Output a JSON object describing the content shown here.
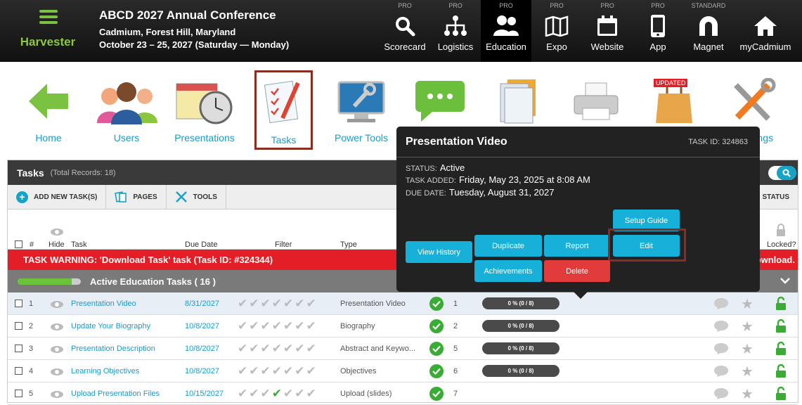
{
  "app": {
    "name": "Harvester"
  },
  "conference": {
    "title": "ABCD 2027 Annual Conference",
    "location": "Cadmium, Forest Hill, Maryland",
    "dates": "October 23 – 25, 2027 (Saturday — Monday)"
  },
  "modules": [
    {
      "tier": "PRO",
      "label": "Scorecard",
      "icon": "search-icon"
    },
    {
      "tier": "PRO",
      "label": "Logistics",
      "icon": "hierarchy-icon"
    },
    {
      "tier": "PRO",
      "label": "Education",
      "icon": "users-icon"
    },
    {
      "tier": "PRO",
      "label": "Expo",
      "icon": "map-icon"
    },
    {
      "tier": "PRO",
      "label": "Website",
      "icon": "calendar-icon"
    },
    {
      "tier": "PRO",
      "label": "App",
      "icon": "phone-icon"
    },
    {
      "tier": "STANDARD",
      "label": "Magnet",
      "icon": "magnet-icon"
    },
    {
      "tier": "",
      "label": "myCadmium",
      "icon": "home-icon"
    }
  ],
  "launcher": [
    {
      "label": "Home",
      "icon": "green-arrow-icon"
    },
    {
      "label": "Users",
      "icon": "people-icon"
    },
    {
      "label": "Presentations",
      "icon": "calendar-clock-icon"
    },
    {
      "label": "Tasks",
      "icon": "checklist-icon"
    },
    {
      "label": "Power Tools",
      "icon": "monitor-wrench-icon"
    },
    {
      "label": "",
      "icon": "chat-bubble-icon"
    },
    {
      "label": "",
      "icon": "documents-icon"
    },
    {
      "label": "",
      "icon": "printer-icon"
    },
    {
      "label": "",
      "icon": "shopping-bag-icon",
      "badge": "UPDATED"
    },
    {
      "label": "ngs",
      "icon": "tools-icon"
    }
  ],
  "panel": {
    "title": "Tasks",
    "count": "(Total Records: 18)",
    "toolbar": {
      "add": "ADD NEW TASK(S)",
      "pages": "PAGES",
      "tools": "TOOLS"
    },
    "status_header": "STATUS",
    "columns": {
      "num": "#",
      "hide": "Hide",
      "task": "Task",
      "due": "Due Date",
      "filter": "Filter",
      "type": "Type",
      "locked": "Locked?"
    },
    "warning": "TASK WARNING: 'Download Task' task (Task ID: #324344)",
    "warning_tail": "ownload.",
    "group": {
      "label": "Active Education Tasks   ( 16 )",
      "progress": 0.85
    },
    "rows": [
      {
        "num": "1",
        "task": "Presentation Video",
        "due": "8/31/2027",
        "type": "Presentation Video",
        "count": "1",
        "progress": "0 % (0 / 8)"
      },
      {
        "num": "2",
        "task": "Update Your Biography",
        "due": "10/8/2027",
        "type": "Biography",
        "count": "2",
        "progress": "0 % (0 / 8)"
      },
      {
        "num": "3",
        "task": "Presentation Description",
        "due": "10/8/2027",
        "type": "Abstract and Keywo...",
        "count": "5",
        "progress": "0 % (0 / 8)"
      },
      {
        "num": "4",
        "task": "Learning Objectives",
        "due": "10/8/2027",
        "type": "Objectives",
        "count": "6",
        "progress": "0 % (0 / 8)"
      },
      {
        "num": "5",
        "task": "Upload Presentation Files",
        "due": "10/15/2027",
        "type": "Upload (slides)",
        "count": "7",
        "progress": ""
      }
    ]
  },
  "popup": {
    "title": "Presentation Video",
    "task_id": "TASK ID: 324863",
    "status_label": "STATUS:",
    "status": "Active",
    "added_label": "TASK ADDED:",
    "added": "Friday, May 23, 2025 at 8:08 AM",
    "due_label": "DUE DATE:",
    "due": "Tuesday, August 31, 2027",
    "buttons": {
      "history": "View History",
      "duplicate": "Duplicate",
      "report": "Report",
      "setup": "Setup Guide",
      "edit": "Edit",
      "achievements": "Achievements",
      "delete": "Delete"
    }
  }
}
